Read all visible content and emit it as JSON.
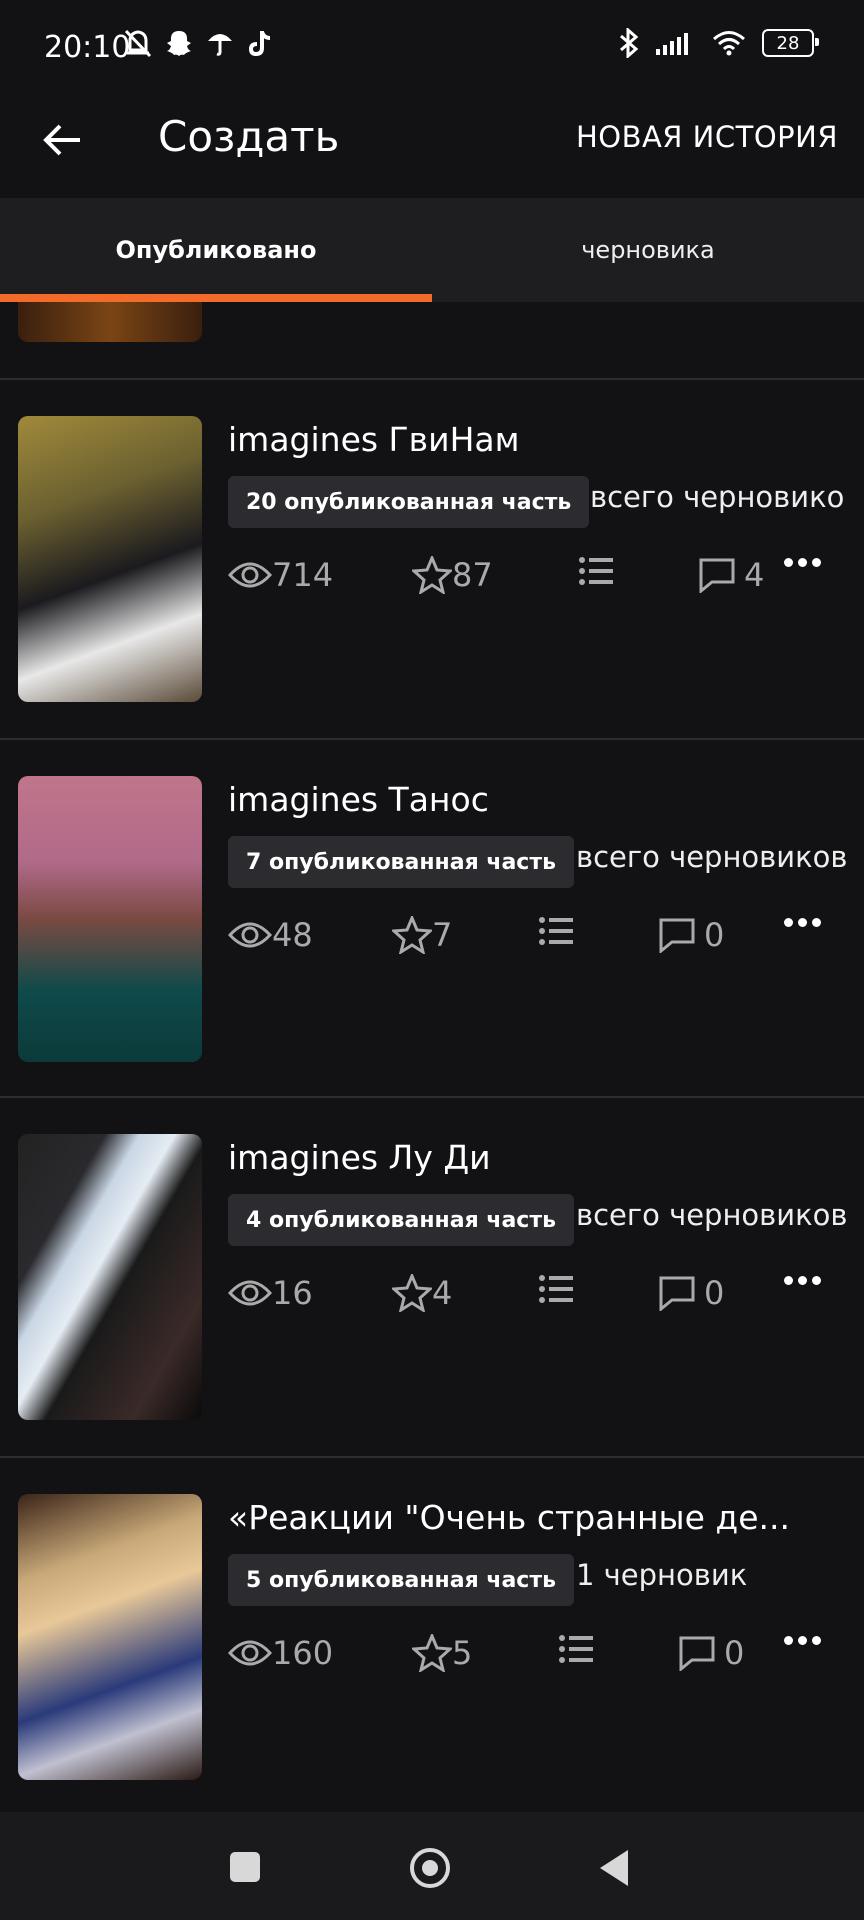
{
  "status_bar": {
    "time": "20:10",
    "battery": "28"
  },
  "header": {
    "title": "Создать",
    "action": "НОВАЯ ИСТОРИЯ"
  },
  "tabs": [
    {
      "label": "Опубликовано",
      "active": true
    },
    {
      "label": "черновика",
      "active": false
    }
  ],
  "colors": {
    "accent": "#f36b2b",
    "background": "#121114",
    "badge": "#2c2b2f"
  },
  "stories": [
    {
      "title": "imagines ГвиНам",
      "published": "20 опубликованная часть",
      "drafts": "всего черновико",
      "views": "714",
      "votes": "87",
      "comments": "4"
    },
    {
      "title": "imagines Танос",
      "published": "7 опубликованная часть",
      "drafts": "всего черновиков",
      "views": "48",
      "votes": "7",
      "comments": "0"
    },
    {
      "title": "imagines Лу Ди",
      "published": "4 опубликованная часть",
      "drafts": "всего черновиков",
      "views": "16",
      "votes": "4",
      "comments": "0"
    },
    {
      "title": "«Реакции \"Очень странные де...",
      "published": "5 опубликованная часть",
      "drafts": "1 черновик",
      "views": "160",
      "votes": "5",
      "comments": "0"
    }
  ]
}
